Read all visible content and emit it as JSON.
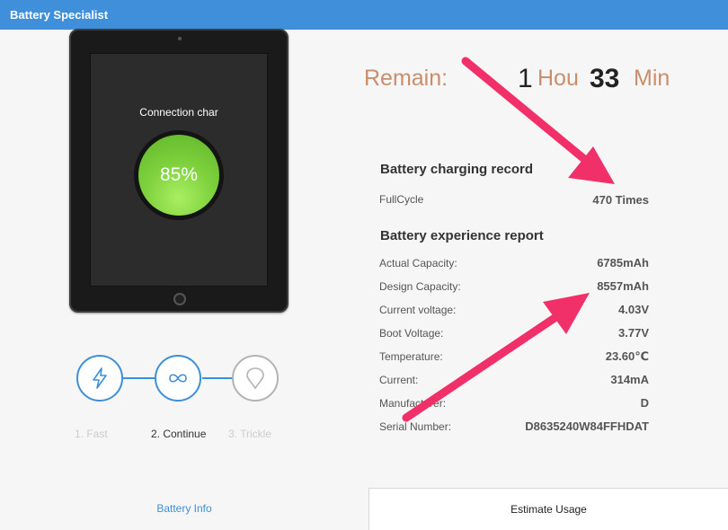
{
  "window": {
    "title": "Battery Specialist"
  },
  "device": {
    "status_text": "Connection char",
    "charge_percent": "85%"
  },
  "modes": [
    {
      "label": "1. Fast",
      "icon": "lightning-icon",
      "active": false
    },
    {
      "label": "2. Continue",
      "icon": "infinity-icon",
      "active": true
    },
    {
      "label": "3. Trickle",
      "icon": "drop-icon",
      "active": false
    }
  ],
  "remain": {
    "label": "Remain:",
    "hours": "1",
    "hours_unit": "Hou",
    "minutes": "33",
    "minutes_unit": "Min"
  },
  "charging_record": {
    "title": "Battery charging record",
    "rows": [
      {
        "label": "FullCycle",
        "value": "470 Times"
      }
    ]
  },
  "experience_report": {
    "title": "Battery experience report",
    "rows": [
      {
        "label": "Actual Capacity:",
        "value": "6785mAh"
      },
      {
        "label": "Design  Capacity:",
        "value": "8557mAh"
      },
      {
        "label": "Current voltage:",
        "value": "4.03V"
      },
      {
        "label": "Boot  Voltage:",
        "value": "3.77V"
      },
      {
        "label": "Temperature:",
        "value": "23.60℃"
      },
      {
        "label": "Current:",
        "value": "314mA"
      },
      {
        "label": "Manufacturer:",
        "value": "D"
      },
      {
        "label": "Serial Number:",
        "value": "D8635240W84FFHDAT"
      }
    ]
  },
  "tabs": {
    "battery_info": "Battery Info",
    "estimate_usage": "Estimate Usage"
  },
  "colors": {
    "titlebar": "#3f8fdb",
    "accent": "#3d8fd8",
    "remain": "#c98e6b",
    "annotation_arrow": "#f1306a",
    "battery_green": "#7fd23d"
  }
}
